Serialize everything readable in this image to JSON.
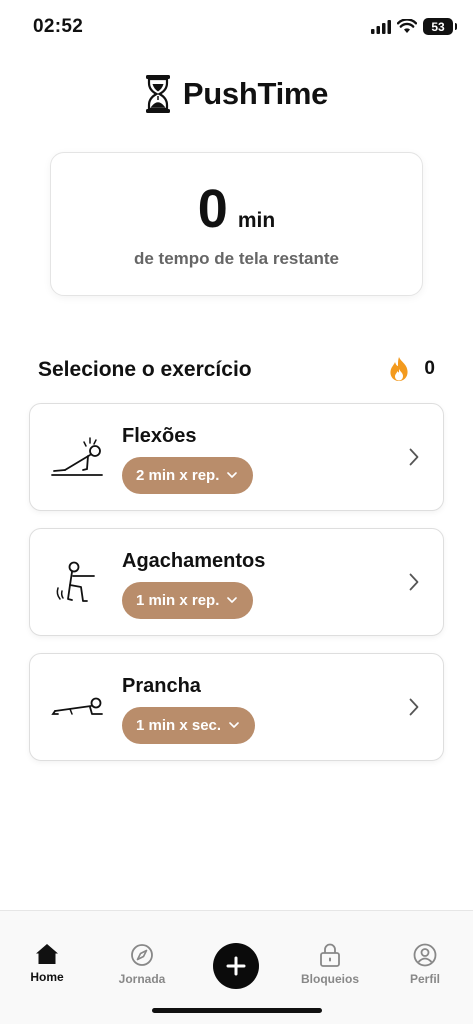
{
  "status_bar": {
    "time": "02:52",
    "battery": "53"
  },
  "app": {
    "title": "PushTime"
  },
  "screen_time": {
    "value": "0",
    "unit": "min",
    "caption": "de tempo de tela restante"
  },
  "section": {
    "title": "Selecione o exercício",
    "streak_count": "0"
  },
  "exercises": [
    {
      "name": "Flexões",
      "rate": "2 min x rep.",
      "icon": "pushup-icon"
    },
    {
      "name": "Agachamentos",
      "rate": "1 min x rep.",
      "icon": "squat-icon"
    },
    {
      "name": "Prancha",
      "rate": "1 min x sec.",
      "icon": "plank-icon"
    }
  ],
  "nav": {
    "home": "Home",
    "journey": "Jornada",
    "blocks": "Bloqueios",
    "profile": "Perfil"
  },
  "colors": {
    "accent": "#b98d6b",
    "flame": "#f39a1e",
    "primary": "#0b0b0b"
  }
}
